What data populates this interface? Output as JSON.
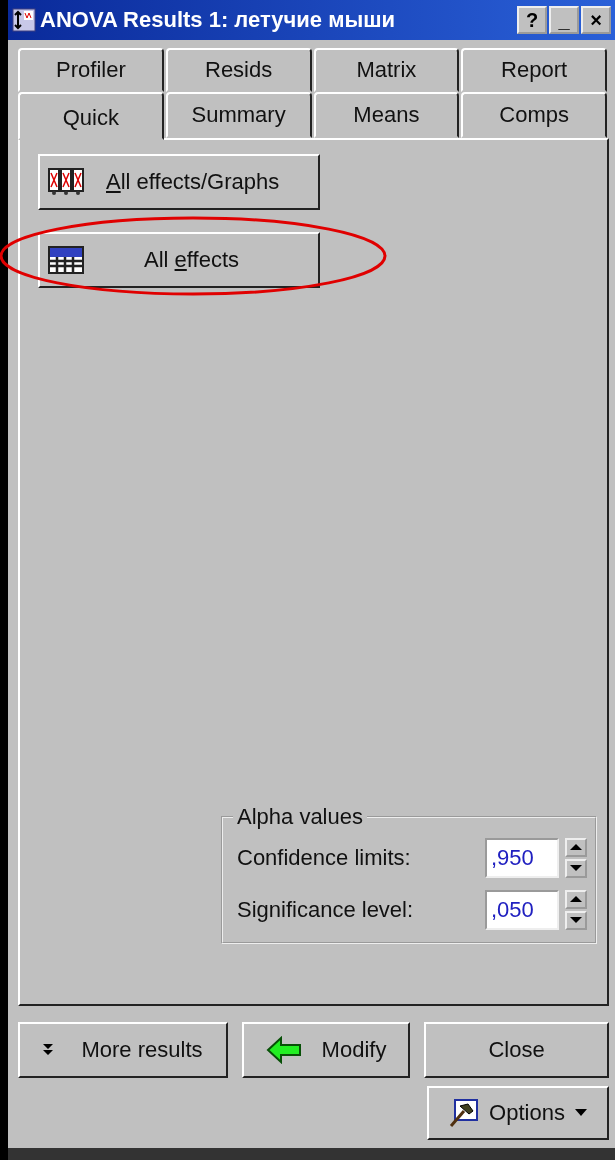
{
  "window": {
    "title": "ANOVA Results 1: летучие мыши",
    "title_buttons": [
      "?",
      "_",
      "×"
    ]
  },
  "tab_rows": [
    [
      {
        "label": "Profiler",
        "selected": false
      },
      {
        "label": "Resids",
        "selected": false
      },
      {
        "label": "Matrix",
        "selected": false
      },
      {
        "label": "Report",
        "selected": false
      }
    ],
    [
      {
        "label": "Quick",
        "selected": true
      },
      {
        "label": "Summary",
        "selected": false
      },
      {
        "label": "Means",
        "selected": false
      },
      {
        "label": "Comps",
        "selected": false
      }
    ]
  ],
  "quick_buttons": [
    {
      "kind": "graphs",
      "key": "A",
      "after": "ll effects/Graphs",
      "highlighted": false
    },
    {
      "kind": "table",
      "before": "All ",
      "key": "e",
      "after": "ffects",
      "highlighted": true
    }
  ],
  "alpha_values": {
    "title": "Alpha values",
    "fields": [
      {
        "label": "Confidence limits:",
        "value": ",950"
      },
      {
        "label": "Significance level:",
        "value": ",050"
      }
    ]
  },
  "footer_buttons": [
    {
      "kind": "more",
      "label": "More results"
    },
    {
      "kind": "modify",
      "label": "Modify"
    },
    {
      "kind": "plain",
      "label": "Close"
    }
  ],
  "options_button": {
    "label": "Options"
  }
}
